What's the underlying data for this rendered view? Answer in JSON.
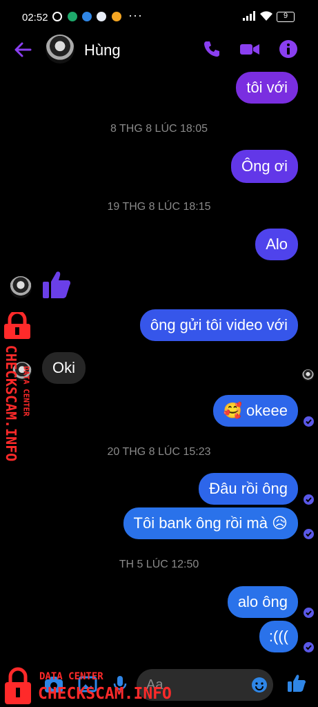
{
  "status_bar": {
    "time": "02:52",
    "battery": "9",
    "more": "···"
  },
  "header": {
    "contact_name": "Hùng",
    "accent": "#8a3ff0"
  },
  "messages": [
    {
      "text": "tôi với"
    },
    {
      "text": "Ông ơi"
    },
    {
      "text": "Alo"
    },
    {
      "text": "ông gửi tôi video với"
    },
    {
      "text": "Oki"
    },
    {
      "text": "🥰 okeee"
    },
    {
      "text": "Đâu rồi ông"
    },
    {
      "text": "Tôi bank ông rồi mà 😥"
    },
    {
      "text": "alo ông"
    },
    {
      "text": ":((("
    }
  ],
  "timestamps": [
    "8 THG 8 LÚC 18:05",
    "19 THG 8 LÚC 18:15",
    "20 THG 8 LÚC 15:23",
    "TH 5 LÚC 12:50"
  ],
  "watermark": {
    "side_small": "DATA CENTER",
    "side_big": "CHECKSCAM.INFO",
    "bottom_small": "DATA CENTER",
    "bottom_big": "CHECKSCAM.INFO"
  },
  "composer": {
    "placeholder": "Aa"
  }
}
